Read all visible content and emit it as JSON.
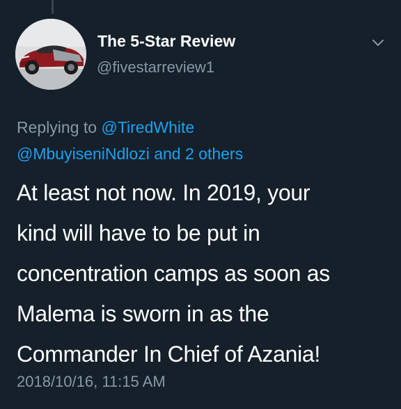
{
  "tweet": {
    "author_name": "The 5-Star Review",
    "author_handle": "@fivestarreview1",
    "replying_prefix": "Replying to ",
    "reply_mention_1": "@TiredWhite",
    "reply_mention_2": "@MbuyiseniNdlozi",
    "reply_and": " and ",
    "reply_others": "2 others",
    "body_lines": [
      "At least not now.  In 2019, your",
      "kind will have to be put in",
      "concentration camps as soon as",
      "Malema is sworn in as the",
      "Commander In Chief of Azania!"
    ],
    "timestamp": "2018/10/16, 11:15 AM"
  },
  "icons": {
    "menu": "chevron-down-icon",
    "avatar": "car-photo"
  },
  "colors": {
    "background": "#15202b",
    "primary_text": "#ffffff",
    "secondary_text": "#8899a6",
    "link": "#1da1f2"
  }
}
